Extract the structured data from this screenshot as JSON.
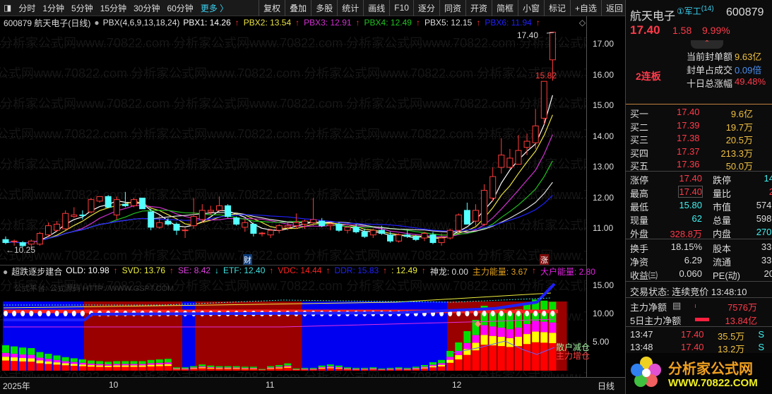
{
  "toolbar": {
    "items": [
      "分时",
      "1分钟",
      "5分钟",
      "15分钟",
      "30分钟",
      "60分钟"
    ],
    "more": "更多 〉",
    "buttons": [
      "复权",
      "叠加",
      "多股",
      "统计",
      "画线",
      "F10",
      "逐分",
      "同资",
      "开资",
      "简框",
      "小窗",
      "标记",
      "+自选",
      "返回"
    ]
  },
  "info": {
    "stock": "600879 航天电子(日线)",
    "formula": "PBX(4,6,9,13,18,24)",
    "pbx": [
      {
        "label": "PBX1: 14.26",
        "color": "#ffffff"
      },
      {
        "label": "PBX2: 13.54",
        "color": "#e8e040"
      },
      {
        "label": "PBX3: 12.91",
        "color": "#d030d0"
      },
      {
        "label": "PBX4: 12.49",
        "color": "#20c020"
      },
      {
        "label": "PBX5: 12.15",
        "color": "#dddddd"
      },
      {
        "label": "PBX6: 11.94",
        "color": "#2020ff"
      }
    ],
    "arrow": "↑"
  },
  "price_axis": [
    "17.00",
    "16.00",
    "15.00",
    "14.00",
    "13.00",
    "12.00",
    "11.00"
  ],
  "ind_axis": [
    "15.00",
    "10.00",
    "5.00"
  ],
  "annotations": {
    "low": "←10.25",
    "high": "17.40",
    "last_high_prev": "15.82",
    "cai": "财",
    "zhang": "涨"
  },
  "indicator": {
    "name": "超跌逐步建合",
    "items": [
      {
        "label": "OLD: 10.98",
        "color": "#ffffff",
        "arrow": "↑"
      },
      {
        "label": "SVD: 13.76",
        "color": "#f0f040",
        "arrow": "↑"
      },
      {
        "label": "SE: 8.42",
        "color": "#e040e0",
        "arrow": "↓"
      },
      {
        "label": "ETF: 12.40",
        "color": "#40e0e0",
        "arrow": "↑"
      },
      {
        "label": "VDC: 14.44",
        "color": "#ff2020",
        "arrow": "↑"
      },
      {
        "label": "DDR: 15.83",
        "color": "#2020ff",
        "arrow": "↑"
      },
      {
        "label": ": 12.49",
        "color": "#f0f040",
        "arrow": "↑"
      },
      {
        "label": "神龙: 0.00",
        "color": "#dddddd",
        "arrow": ""
      },
      {
        "label": "主力能量: 3.67",
        "color": "#e0a020",
        "arrow": "↑"
      },
      {
        "label": "大户能量: 2.80",
        "color": "#e020e0",
        "arrow": ""
      }
    ],
    "watermark": "公式平台: 公式源码 HTTP://WWW.GSPT.COM",
    "legend": [
      "散户减仓",
      "主力增仓"
    ]
  },
  "dates": [
    "2025年",
    "10",
    "11",
    "12"
  ],
  "period": "日线",
  "watermark": "分析家公式网www.70822.com",
  "panel": {
    "name": "航天电子",
    "tag": "①军工",
    "tag_num": "(14)",
    "code": "600879",
    "price": "17.40",
    "change": "1.58",
    "pct": "9.99%",
    "board": "2连板",
    "seal": [
      {
        "k": "当前封单额",
        "v": "9.63亿",
        "c": "yel"
      },
      {
        "k": "封单占成交",
        "v": "0.09倍",
        "c": "blu"
      },
      {
        "k": "十日总涨幅",
        "v": "49.48%",
        "c": "red"
      }
    ],
    "bids": [
      {
        "k": "买一",
        "p": "17.40",
        "v": "9.6亿"
      },
      {
        "k": "买二",
        "p": "17.39",
        "v": "19.7万"
      },
      {
        "k": "买三",
        "p": "17.38",
        "v": "20.5万"
      },
      {
        "k": "买四",
        "p": "17.37",
        "v": "213.3万"
      },
      {
        "k": "买五",
        "p": "17.36",
        "v": "50.0万"
      }
    ],
    "stats1": [
      {
        "k": "涨停",
        "v": "17.40",
        "c": "red",
        "k2": "跌停",
        "v2": "14",
        "c2": "cyan"
      },
      {
        "k": "最高",
        "v": "17.40",
        "c": "red",
        "k2": "量比",
        "v2": "2",
        "c2": "red"
      },
      {
        "k": "最低",
        "v": "15.80",
        "c": "cyan",
        "k2": "市值",
        "v2": "574.",
        "c2": "wht"
      },
      {
        "k": "现量",
        "v": "62",
        "c": "cyan",
        "k2": "总量",
        "v2": "598.",
        "c2": "wht"
      },
      {
        "k": "外盘",
        "v": "328.8万",
        "c": "red",
        "k2": "内盘",
        "v2": "270.",
        "c2": "cyan"
      }
    ],
    "stats2": [
      {
        "k": "换手",
        "v": "18.15%",
        "k2": "股本",
        "v2": "33."
      },
      {
        "k": "净资",
        "v": "6.29",
        "k2": "流通",
        "v2": "33."
      },
      {
        "k": "收益㈢",
        "v": "0.060",
        "k2": "PE(动)",
        "v2": "20"
      }
    ],
    "status": "交易状态: 连续竞价 13:48:10",
    "flow": [
      {
        "k": "主力净额",
        "v": "7576万"
      },
      {
        "k": "5日主力净额",
        "v": "13.84亿"
      }
    ],
    "ticks": [
      {
        "t": "13:47",
        "p": "17.40",
        "v": "35.5万",
        "s": "S"
      },
      {
        "t": "13:48",
        "p": "17.40",
        "v": "13.2万",
        "s": "S"
      }
    ],
    "logo": {
      "title": "分析家公式网",
      "url": "WWW.70822.COM"
    }
  },
  "colors": {
    "up": "#ff3b3b",
    "down": "#54ffff",
    "ma": [
      "#ffffff",
      "#e8e040",
      "#d030d0",
      "#20c020",
      "#dddddd",
      "#2020ff"
    ]
  },
  "chart_data": {
    "type": "candlestick",
    "ma_periods": [
      4,
      6,
      9,
      13,
      18,
      24
    ],
    "ylim": [
      10.2,
      17.6
    ],
    "ohlc": [
      [
        10.65,
        10.75,
        10.5,
        10.55
      ],
      [
        10.6,
        10.65,
        10.45,
        10.6
      ],
      [
        10.55,
        10.6,
        10.4,
        10.45
      ],
      [
        10.5,
        10.65,
        10.35,
        10.6
      ],
      [
        10.5,
        10.9,
        10.45,
        10.85
      ],
      [
        10.8,
        11.2,
        10.75,
        11.1
      ],
      [
        10.95,
        11.25,
        10.9,
        11.15
      ],
      [
        11.0,
        11.6,
        10.95,
        11.5
      ],
      [
        11.4,
        11.7,
        11.35,
        11.45
      ],
      [
        11.45,
        11.6,
        11.3,
        11.44
      ],
      [
        11.55,
        12.0,
        11.5,
        11.95
      ],
      [
        11.9,
        12.05,
        11.85,
        12.05
      ],
      [
        12.05,
        12.1,
        11.7,
        11.7
      ],
      [
        11.45,
        12.05,
        11.3,
        11.95
      ],
      [
        11.8,
        12.2,
        11.7,
        11.75
      ],
      [
        11.75,
        12.0,
        11.7,
        11.95
      ],
      [
        12.0,
        12.0,
        11.65,
        11.65
      ],
      [
        11.55,
        11.65,
        10.95,
        11.05
      ],
      [
        11.05,
        11.45,
        11.0,
        11.2
      ],
      [
        11.25,
        11.35,
        11.1,
        11.15
      ],
      [
        11.15,
        11.2,
        10.8,
        10.95
      ],
      [
        10.95,
        11.05,
        10.7,
        10.96
      ],
      [
        11.1,
        12.0,
        11.0,
        11.4
      ],
      [
        11.3,
        11.8,
        11.2,
        11.6
      ],
      [
        11.55,
        11.75,
        11.45,
        11.6
      ],
      [
        11.6,
        12.05,
        11.55,
        11.75
      ],
      [
        11.75,
        11.8,
        11.35,
        11.4
      ],
      [
        11.35,
        11.4,
        11.1,
        11.15
      ],
      [
        11.05,
        11.3,
        10.9,
        11.2
      ],
      [
        11.15,
        11.2,
        10.75,
        10.85
      ],
      [
        10.85,
        10.9,
        10.75,
        10.86
      ],
      [
        10.8,
        11.0,
        10.7,
        10.95
      ],
      [
        10.95,
        11.15,
        10.85,
        11.1
      ],
      [
        11.05,
        11.2,
        10.95,
        11.1
      ],
      [
        11.1,
        11.5,
        11.0,
        11.2
      ],
      [
        11.15,
        11.3,
        11.0,
        11.25
      ],
      [
        11.2,
        12.0,
        11.1,
        11.3
      ],
      [
        11.25,
        11.35,
        11.05,
        11.1
      ],
      [
        11.1,
        11.2,
        10.95,
        11.15
      ],
      [
        11.15,
        11.2,
        10.9,
        10.95
      ],
      [
        10.95,
        11.1,
        10.85,
        11.05
      ],
      [
        11.05,
        11.15,
        10.85,
        10.9
      ],
      [
        10.9,
        11.0,
        10.7,
        10.75
      ],
      [
        10.8,
        11.0,
        10.7,
        10.95
      ],
      [
        10.95,
        11.1,
        10.8,
        10.85
      ],
      [
        10.8,
        10.9,
        10.55,
        10.6
      ],
      [
        10.6,
        10.85,
        10.55,
        10.8
      ],
      [
        10.8,
        10.95,
        10.7,
        10.75
      ],
      [
        10.75,
        10.8,
        10.6,
        10.65
      ],
      [
        10.7,
        10.9,
        10.6,
        10.85
      ],
      [
        10.8,
        10.9,
        10.5,
        10.55
      ],
      [
        10.55,
        10.85,
        10.45,
        10.7
      ],
      [
        10.7,
        11.0,
        10.65,
        10.95
      ],
      [
        10.95,
        11.5,
        10.9,
        11.45
      ],
      [
        11.6,
        11.85,
        11.15,
        11.15
      ],
      [
        11.25,
        11.8,
        11.1,
        11.6
      ],
      [
        11.15,
        12.45,
        11.1,
        12.25
      ],
      [
        12.0,
        13.0,
        11.9,
        12.7
      ],
      [
        13.0,
        13.95,
        12.8,
        13.4
      ],
      [
        13.0,
        13.6,
        12.95,
        13.3
      ],
      [
        13.1,
        14.05,
        13.1,
        13.55
      ],
      [
        13.65,
        14.1,
        13.4,
        13.85
      ],
      [
        13.8,
        14.9,
        13.6,
        14.35
      ],
      [
        14.6,
        15.8,
        14.4,
        15.8
      ],
      [
        16.5,
        17.4,
        15.82,
        17.4
      ]
    ],
    "ind_bars": [
      4.5,
      4.3,
      4.1,
      4.0,
      3.3,
      3.0,
      2.7,
      2.4,
      2.2,
      2.0,
      1.8,
      1.7,
      1.6,
      1.7,
      1.7,
      1.7,
      1.7,
      1.9,
      2.0,
      2.1,
      0.6,
      0.6,
      0.8,
      1.1,
      0.9,
      0.8,
      0.8,
      0.8,
      0.7,
      0.7,
      0.3,
      0.8,
      1.0,
      1.3,
      0.4,
      0.5,
      0.5,
      0.9,
      1.1,
      0.9,
      0.6,
      0.5,
      0.5,
      0.6,
      0.4,
      0.5,
      0.6,
      0.5,
      0.7,
      1.0,
      1.5,
      1.9,
      3.5,
      5.0,
      7.0,
      9.0,
      11.5,
      11.2,
      10.9,
      10.5,
      10.9,
      11.8,
      12.6,
      12.4,
      12.2
    ],
    "ind_bg": [
      {
        "from": 0,
        "to": 9.5,
        "color": "#0000f0"
      },
      {
        "from": 9.5,
        "to": 21,
        "color": "#9a0000"
      },
      {
        "from": 21,
        "to": 22.5,
        "color": "#0000f0"
      },
      {
        "from": 22.5,
        "to": 35,
        "color": "#9a0000"
      },
      {
        "from": 35,
        "to": 52,
        "color": "#0000f0"
      },
      {
        "from": 52,
        "to": 66,
        "color": "#9a0000"
      }
    ]
  }
}
